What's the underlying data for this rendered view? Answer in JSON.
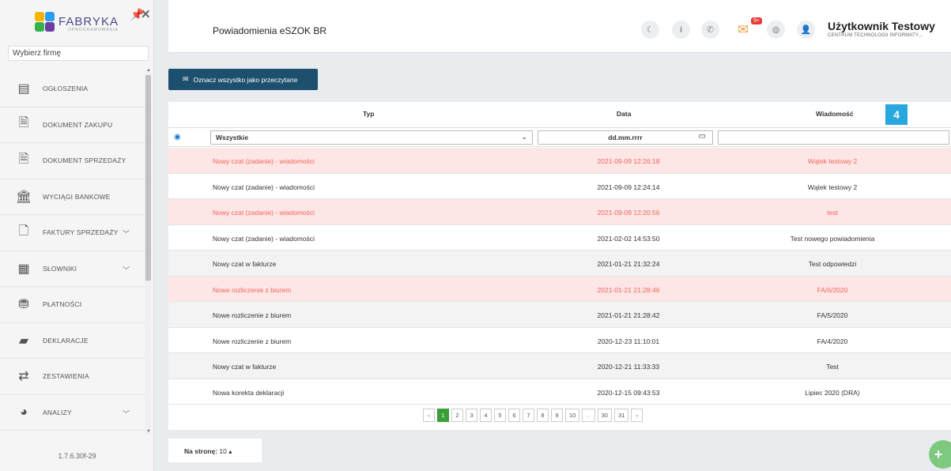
{
  "sidebar": {
    "logo_text": "FABRYKA",
    "logo_sub": "OPROGRAMOWANIA",
    "company_select": "Wybierz firmę",
    "items": [
      {
        "label": "OGŁOSZENIA",
        "icon": "newspaper-icon"
      },
      {
        "label": "DOKUMENT ZAKUPU",
        "icon": "document-icon"
      },
      {
        "label": "DOKUMENT SPRZEDAŻY",
        "icon": "document-icon"
      },
      {
        "label": "WYCIĄGI BANKOWE",
        "icon": "bank-icon"
      },
      {
        "label": "FAKTURY SPRZEDAŻY",
        "icon": "file-icon",
        "has_chevron": true
      },
      {
        "label": "SŁOWNIKI",
        "icon": "table-icon",
        "has_chevron": true
      },
      {
        "label": "PŁATNOŚCI",
        "icon": "coins-icon"
      },
      {
        "label": "DEKLARACJE",
        "icon": "book-icon"
      },
      {
        "label": "ZESTAWIENIA",
        "icon": "exchange-icon"
      },
      {
        "label": "ANALIZY",
        "icon": "pie-chart-icon",
        "has_chevron": true
      }
    ],
    "version": "1.7.6.30f-29"
  },
  "header": {
    "title": "Powiadomienia eSZOK BR",
    "mail_badge": "9+",
    "user_name": "Użytkownik Testowy",
    "user_company": "CENTRUM TECHNOLOGII INFORMATY..."
  },
  "main": {
    "mark_all_label": "Oznacz wszystko jako przeczytane",
    "highlight_badge": "4",
    "columns": {
      "type": "Typ",
      "date": "Data",
      "message": "Wiadomość"
    },
    "filters": {
      "type_value": "Wszystkie",
      "date_placeholder": "dd.mm.rrrr",
      "message_value": ""
    },
    "rows": [
      {
        "type": "Nowy czat (zadanie) - wiadomości",
        "date": "2021-09-09 12:26:18",
        "message": "Wątek testowy 2",
        "unread": true
      },
      {
        "type": "Nowy czat (zadanie) - wiadomości",
        "date": "2021-09-09 12:24:14",
        "message": "Wątek testowy 2",
        "unread": false
      },
      {
        "type": "Nowy czat (zadanie) - wiadomości",
        "date": "2021-09-09 12:20:56",
        "message": "test",
        "unread": true
      },
      {
        "type": "Nowy czat (zadanie) - wiadomości",
        "date": "2021-02-02 14:53:50",
        "message": "Test nowego powiadomienia",
        "unread": false
      },
      {
        "type": "Nowy czat w fakturze",
        "date": "2021-01-21 21:32:24",
        "message": "Test odpowiedzi",
        "unread": false
      },
      {
        "type": "Nowe rozliczenie z biurem",
        "date": "2021-01-21 21:28:46",
        "message": "FA/6/2020",
        "unread": true
      },
      {
        "type": "Nowe rozliczenie z biurem",
        "date": "2021-01-21 21:28:42",
        "message": "FA/5/2020",
        "unread": false
      },
      {
        "type": "Nowe rozliczenie z biurem",
        "date": "2020-12-23 11:10:01",
        "message": "FA/4/2020",
        "unread": false
      },
      {
        "type": "Nowy czat w fakturze",
        "date": "2020-12-21 11:33:33",
        "message": "Test",
        "unread": false
      },
      {
        "type": "Nowa korekta deklaracji",
        "date": "2020-12-15 09:43:53",
        "message": "Lipiec 2020 (DRA)",
        "unread": false
      }
    ],
    "pagination": [
      "«",
      "1",
      "2",
      "3",
      "4",
      "5",
      "6",
      "7",
      "8",
      "9",
      "10",
      "...",
      "30",
      "31",
      "»"
    ],
    "current_page": "1",
    "per_page_label": "Na stronę:",
    "per_page_value": "10"
  },
  "colors": {
    "accent_button": "#1d4f6e",
    "unread_row": "#fde6e6",
    "unread_text": "#f0655a",
    "active_page": "#3a9f3a",
    "badge_blue": "#29a8e0"
  }
}
